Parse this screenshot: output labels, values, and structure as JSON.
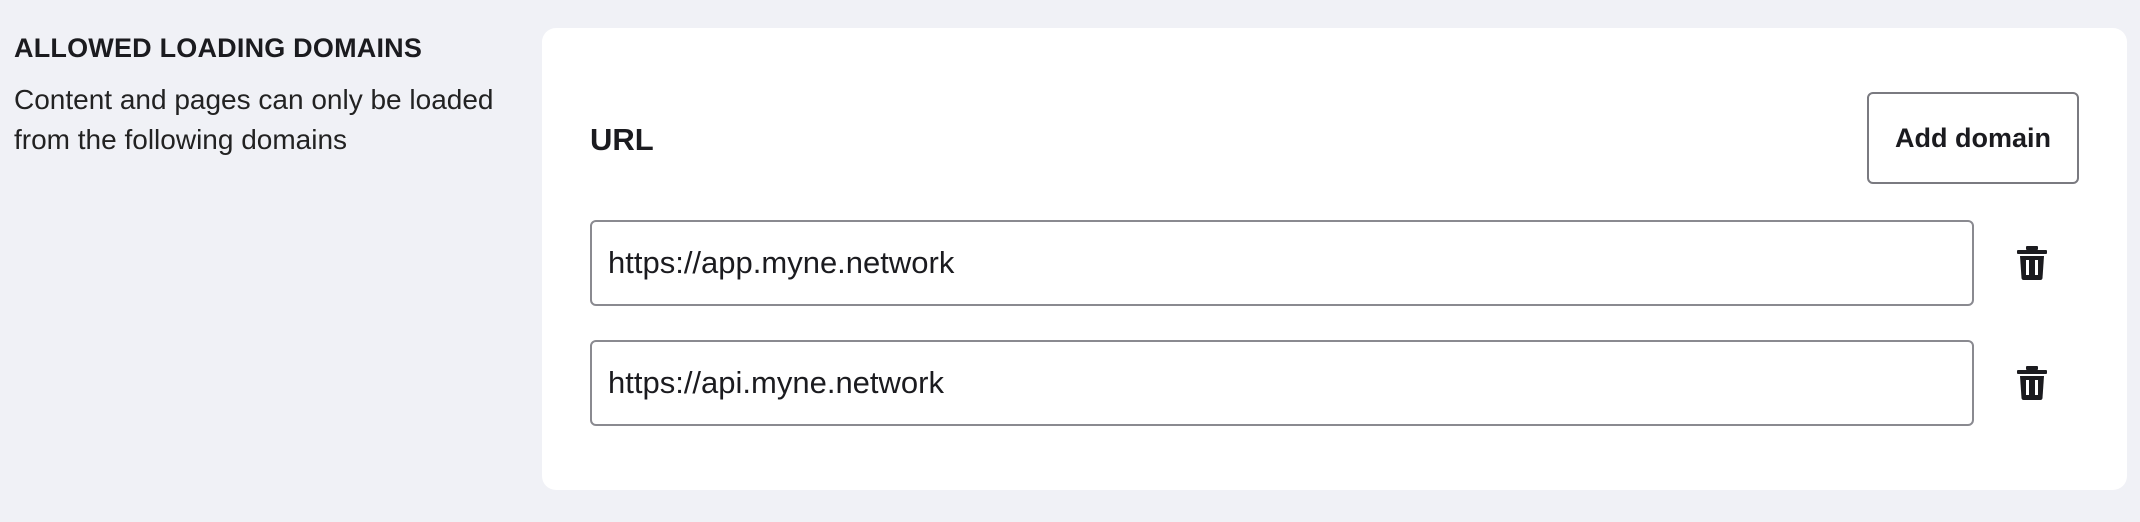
{
  "section": {
    "title": "ALLOWED LOADING DOMAINS",
    "description": "Content and pages can only be loaded from the following domains"
  },
  "card": {
    "url_heading": "URL",
    "add_domain_label": "Add domain",
    "domains": [
      {
        "value": "https://app.myne.network",
        "delete_icon": "trash-icon"
      },
      {
        "value": "https://api.myne.network",
        "delete_icon": "trash-icon"
      }
    ]
  },
  "colors": {
    "page_background": "#f0f1f6",
    "card_background": "#ffffff",
    "text": "#1b1b1f",
    "border": "#8a8a90"
  }
}
